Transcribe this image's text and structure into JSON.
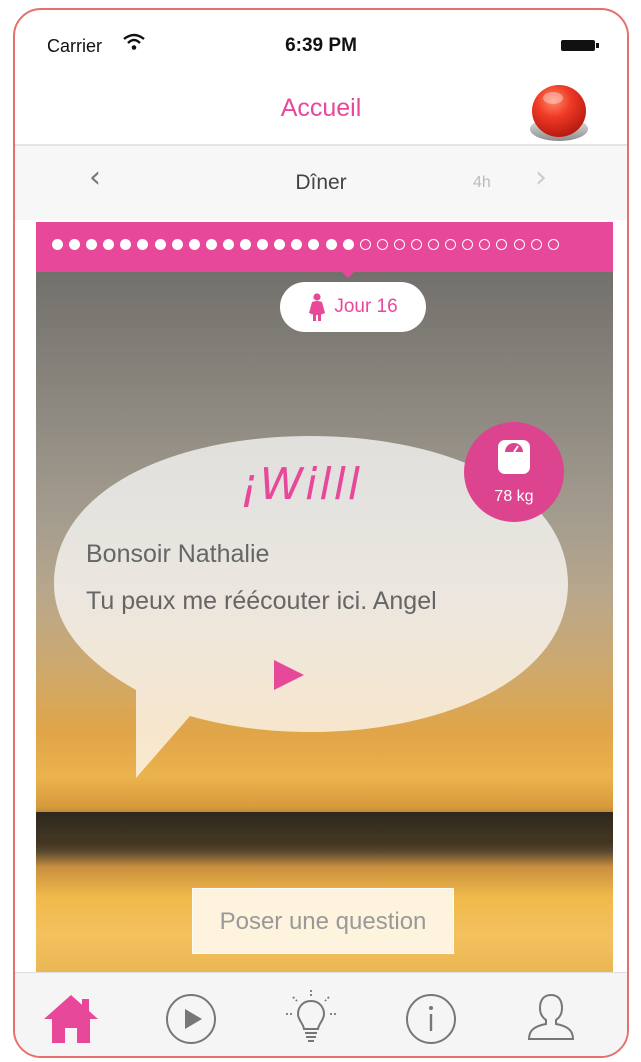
{
  "status_bar": {
    "carrier": "Carrier",
    "time": "6:39 PM"
  },
  "nav": {
    "title": "Accueil",
    "panic_button_icon": "red-alarm-button-icon"
  },
  "meal": {
    "name": "Dîner",
    "time_left": "4h",
    "prev_icon": "chevron-left-icon",
    "next_icon": "chevron-right-icon"
  },
  "progress": {
    "days_total": 30,
    "days_done": 18,
    "current_day_label": "Jour 16"
  },
  "message": {
    "brand": "¡Willl",
    "greeting": "Bonsoir Nathalie",
    "text": "Tu peux me réécouter ici. Angel",
    "play_icon": "play-icon"
  },
  "weight": {
    "value": "78 kg",
    "icon": "scale-icon"
  },
  "ask_button": {
    "label": "Poser une question"
  },
  "tabs": [
    {
      "name": "home",
      "icon": "home-icon",
      "active": true
    },
    {
      "name": "play",
      "icon": "play-circle-icon",
      "active": false
    },
    {
      "name": "tips",
      "icon": "lightbulb-icon",
      "active": false
    },
    {
      "name": "info",
      "icon": "info-icon",
      "active": false
    },
    {
      "name": "profile",
      "icon": "user-icon",
      "active": false
    }
  ],
  "colors": {
    "accent": "#e8489a",
    "frame_border": "#e6706e",
    "panic": "#e23b2a"
  }
}
